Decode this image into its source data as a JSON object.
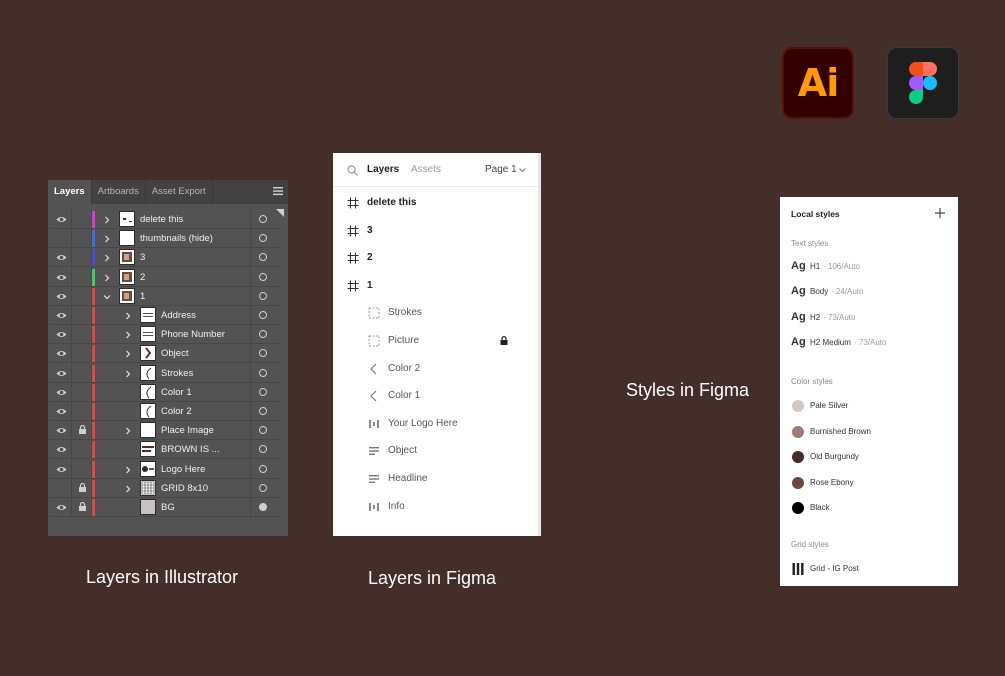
{
  "captions": {
    "illustrator": "Layers in Illustrator",
    "figma_layers": "Layers in Figma",
    "figma_styles": "Styles in Figma"
  },
  "app_icons": {
    "illustrator": {
      "text": "Ai",
      "color": "#ff9a00",
      "bg": "#330000"
    },
    "figma": {
      "icon": "figma-logo-icon",
      "bg": "#1e1e1e"
    }
  },
  "illustrator": {
    "tabs": [
      "Layers",
      "Artboards",
      "Asset Export"
    ],
    "layers": [
      {
        "name": "delete this",
        "level": 0,
        "expand": "collapsed",
        "color": "#d23fd6",
        "thumb": "white-mark",
        "visible": true,
        "locked": false,
        "selected_target": false
      },
      {
        "name": "thumbnails (hide)",
        "level": 0,
        "expand": "collapsed",
        "color": "#3e6fe0",
        "thumb": "white",
        "visible": false,
        "locked": false,
        "selected_target": false
      },
      {
        "name": "3",
        "level": 0,
        "expand": "collapsed",
        "color": "#4a49e0",
        "thumb": "photo",
        "visible": true,
        "locked": false,
        "selected_target": false
      },
      {
        "name": "2",
        "level": 0,
        "expand": "collapsed",
        "color": "#3ed05a",
        "thumb": "photo",
        "visible": true,
        "locked": false,
        "selected_target": false
      },
      {
        "name": "1",
        "level": 0,
        "expand": "expanded",
        "color": "#e04848",
        "thumb": "photo",
        "visible": true,
        "locked": false,
        "selected_target": false
      },
      {
        "name": "Address",
        "level": 1,
        "expand": "collapsed",
        "color": "#e04848",
        "thumb": "lines",
        "visible": true,
        "locked": false,
        "selected_target": false
      },
      {
        "name": "Phone Number",
        "level": 1,
        "expand": "collapsed",
        "color": "#e04848",
        "thumb": "lines",
        "visible": true,
        "locked": false,
        "selected_target": false
      },
      {
        "name": "Object",
        "level": 1,
        "expand": "collapsed",
        "color": "#e04848",
        "thumb": "pattern",
        "visible": true,
        "locked": false,
        "selected_target": false
      },
      {
        "name": "Strokes",
        "level": 1,
        "expand": "collapsed",
        "color": "#e04848",
        "thumb": "curve",
        "visible": true,
        "locked": false,
        "selected_target": false
      },
      {
        "name": "Color 1",
        "level": 1,
        "expand": "none",
        "color": "#e04848",
        "thumb": "curve",
        "visible": true,
        "locked": false,
        "selected_target": false
      },
      {
        "name": "Color 2",
        "level": 1,
        "expand": "none",
        "color": "#e04848",
        "thumb": "curve",
        "visible": true,
        "locked": false,
        "selected_target": false
      },
      {
        "name": "Place Image",
        "level": 1,
        "expand": "collapsed",
        "color": "#e04848",
        "thumb": "white",
        "visible": true,
        "locked": true,
        "selected_target": false
      },
      {
        "name": "BROWN IS ...",
        "level": 1,
        "expand": "none",
        "color": "#e04848",
        "thumb": "text",
        "visible": true,
        "locked": false,
        "selected_target": false
      },
      {
        "name": "Logo Here",
        "level": 1,
        "expand": "collapsed",
        "color": "#e04848",
        "thumb": "logo",
        "visible": true,
        "locked": false,
        "selected_target": false
      },
      {
        "name": "GRID 8x10",
        "level": 1,
        "expand": "collapsed",
        "color": "#e04848",
        "thumb": "grid",
        "visible": false,
        "locked": true,
        "selected_target": false
      },
      {
        "name": "BG",
        "level": 1,
        "expand": "none",
        "color": "#e04848",
        "thumb": "gray",
        "visible": true,
        "locked": true,
        "selected_target": true
      }
    ]
  },
  "figma_layers": {
    "tabs": [
      "Layers",
      "Assets"
    ],
    "page": "Page 1",
    "items": [
      {
        "label": "delete this",
        "icon": "frame-icon",
        "level": 0,
        "locked": false
      },
      {
        "label": "3",
        "icon": "frame-icon",
        "level": 0,
        "locked": false
      },
      {
        "label": "2",
        "icon": "frame-icon",
        "level": 0,
        "locked": false
      },
      {
        "label": "1",
        "icon": "frame-icon",
        "level": 0,
        "locked": false
      },
      {
        "label": "Strokes",
        "icon": "group-icon",
        "level": 1,
        "locked": false
      },
      {
        "label": "Picture",
        "icon": "group-icon",
        "level": 1,
        "locked": true
      },
      {
        "label": "Color 2",
        "icon": "vector-icon",
        "level": 1,
        "locked": false
      },
      {
        "label": "Color 1",
        "icon": "vector-icon",
        "level": 1,
        "locked": false
      },
      {
        "label": "Your Logo Here",
        "icon": "autolayout-icon",
        "level": 1,
        "locked": false
      },
      {
        "label": "Object",
        "icon": "text-icon",
        "level": 1,
        "locked": false
      },
      {
        "label": "Headline",
        "icon": "text-icon",
        "level": 1,
        "locked": false
      },
      {
        "label": "Info",
        "icon": "autolayout-icon",
        "level": 1,
        "locked": false
      }
    ]
  },
  "figma_styles": {
    "title": "Local styles",
    "text_heading": "Text styles",
    "text_styles": [
      {
        "sample": "Ag",
        "name": "H1",
        "meta": "· 106/Auto"
      },
      {
        "sample": "Ag",
        "name": "Body",
        "meta": "· 24/Auto"
      },
      {
        "sample": "Ag",
        "name": "H2",
        "meta": "· 73/Auto"
      },
      {
        "sample": "Ag",
        "name": "H2 Medium",
        "meta": "· 73/Auto"
      }
    ],
    "color_heading": "Color styles",
    "color_styles": [
      {
        "name": "Pale Silver",
        "color": "#d2c6c3"
      },
      {
        "name": "Burnished Brown",
        "color": "#a07a76"
      },
      {
        "name": "Old Burgundy",
        "color": "#452d29"
      },
      {
        "name": "Rose Ebony",
        "color": "#6d4641"
      },
      {
        "name": "Black",
        "color": "#000000"
      }
    ],
    "grid_heading": "Grid styles",
    "grid_styles": [
      {
        "name": "Grid - IG Post"
      }
    ]
  }
}
